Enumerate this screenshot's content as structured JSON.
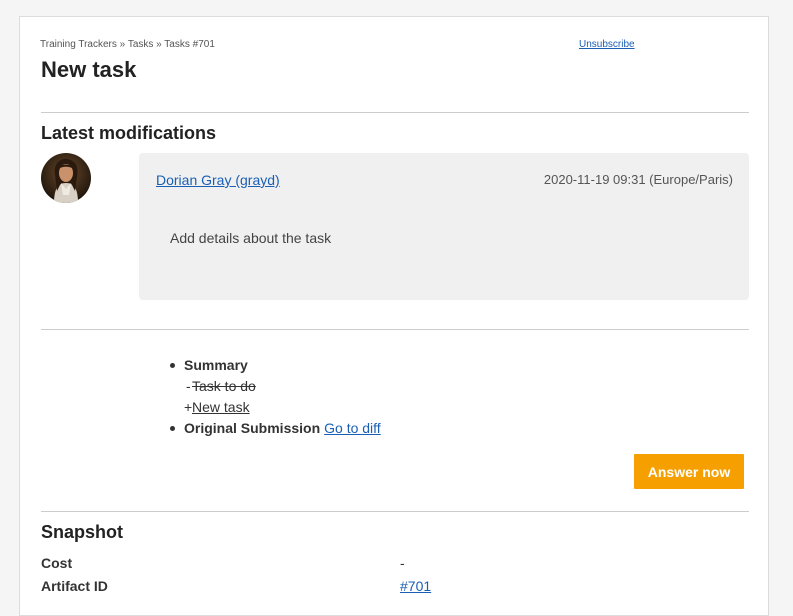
{
  "breadcrumb": "Training Trackers » Tasks » Tasks #701",
  "unsubscribe_label": "Unsubscribe",
  "page_title": "New task",
  "latest_modifications": {
    "heading": "Latest modifications",
    "author": "Dorian Gray (grayd)",
    "timestamp": "2020-11-19 09:31 (Europe/Paris)",
    "comment": "Add details about the task"
  },
  "changes": {
    "summary_label": "Summary",
    "summary_removed_sign": "-",
    "summary_old": "Task to do",
    "summary_added_sign": "+",
    "summary_new": "New task",
    "original_submission_label": "Original Submission",
    "go_to_diff_label": "Go to diff"
  },
  "answer_button_label": "Answer now",
  "snapshot": {
    "heading": "Snapshot",
    "fields": [
      {
        "label": "Cost",
        "value": "-"
      },
      {
        "label": "Artifact ID",
        "value": "#701"
      }
    ]
  },
  "colors": {
    "link": "#1a5fb4",
    "accent_button": "#f5a000",
    "comment_background": "#f0f0f0"
  }
}
